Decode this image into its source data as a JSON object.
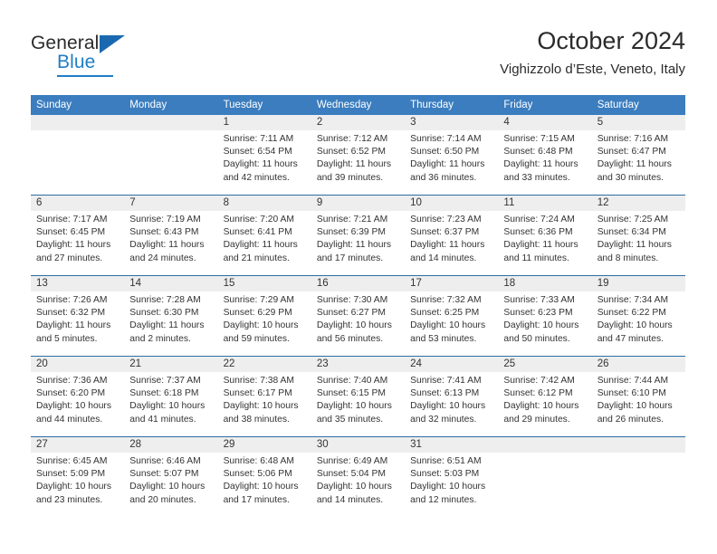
{
  "brand": {
    "name_part1": "General",
    "name_part2": "Blue",
    "accent_color": "#1f7ec4",
    "triangle_color": "#1a69b0"
  },
  "header": {
    "title": "October 2024",
    "subtitle": "Vighizzolo d’Este, Veneto, Italy"
  },
  "calendar": {
    "header_bg": "#3b7dbf",
    "row_rule_color": "#2e6da4",
    "daynum_bg": "#eeeeee",
    "weekdays": [
      "Sunday",
      "Monday",
      "Tuesday",
      "Wednesday",
      "Thursday",
      "Friday",
      "Saturday"
    ],
    "weeks": [
      [
        {
          "day": "",
          "empty": true
        },
        {
          "day": "",
          "empty": true
        },
        {
          "day": "1",
          "sunrise": "Sunrise: 7:11 AM",
          "sunset": "Sunset: 6:54 PM",
          "daylight1": "Daylight: 11 hours",
          "daylight2": "and 42 minutes."
        },
        {
          "day": "2",
          "sunrise": "Sunrise: 7:12 AM",
          "sunset": "Sunset: 6:52 PM",
          "daylight1": "Daylight: 11 hours",
          "daylight2": "and 39 minutes."
        },
        {
          "day": "3",
          "sunrise": "Sunrise: 7:14 AM",
          "sunset": "Sunset: 6:50 PM",
          "daylight1": "Daylight: 11 hours",
          "daylight2": "and 36 minutes."
        },
        {
          "day": "4",
          "sunrise": "Sunrise: 7:15 AM",
          "sunset": "Sunset: 6:48 PM",
          "daylight1": "Daylight: 11 hours",
          "daylight2": "and 33 minutes."
        },
        {
          "day": "5",
          "sunrise": "Sunrise: 7:16 AM",
          "sunset": "Sunset: 6:47 PM",
          "daylight1": "Daylight: 11 hours",
          "daylight2": "and 30 minutes."
        }
      ],
      [
        {
          "day": "6",
          "sunrise": "Sunrise: 7:17 AM",
          "sunset": "Sunset: 6:45 PM",
          "daylight1": "Daylight: 11 hours",
          "daylight2": "and 27 minutes."
        },
        {
          "day": "7",
          "sunrise": "Sunrise: 7:19 AM",
          "sunset": "Sunset: 6:43 PM",
          "daylight1": "Daylight: 11 hours",
          "daylight2": "and 24 minutes."
        },
        {
          "day": "8",
          "sunrise": "Sunrise: 7:20 AM",
          "sunset": "Sunset: 6:41 PM",
          "daylight1": "Daylight: 11 hours",
          "daylight2": "and 21 minutes."
        },
        {
          "day": "9",
          "sunrise": "Sunrise: 7:21 AM",
          "sunset": "Sunset: 6:39 PM",
          "daylight1": "Daylight: 11 hours",
          "daylight2": "and 17 minutes."
        },
        {
          "day": "10",
          "sunrise": "Sunrise: 7:23 AM",
          "sunset": "Sunset: 6:37 PM",
          "daylight1": "Daylight: 11 hours",
          "daylight2": "and 14 minutes."
        },
        {
          "day": "11",
          "sunrise": "Sunrise: 7:24 AM",
          "sunset": "Sunset: 6:36 PM",
          "daylight1": "Daylight: 11 hours",
          "daylight2": "and 11 minutes."
        },
        {
          "day": "12",
          "sunrise": "Sunrise: 7:25 AM",
          "sunset": "Sunset: 6:34 PM",
          "daylight1": "Daylight: 11 hours",
          "daylight2": "and 8 minutes."
        }
      ],
      [
        {
          "day": "13",
          "sunrise": "Sunrise: 7:26 AM",
          "sunset": "Sunset: 6:32 PM",
          "daylight1": "Daylight: 11 hours",
          "daylight2": "and 5 minutes."
        },
        {
          "day": "14",
          "sunrise": "Sunrise: 7:28 AM",
          "sunset": "Sunset: 6:30 PM",
          "daylight1": "Daylight: 11 hours",
          "daylight2": "and 2 minutes."
        },
        {
          "day": "15",
          "sunrise": "Sunrise: 7:29 AM",
          "sunset": "Sunset: 6:29 PM",
          "daylight1": "Daylight: 10 hours",
          "daylight2": "and 59 minutes."
        },
        {
          "day": "16",
          "sunrise": "Sunrise: 7:30 AM",
          "sunset": "Sunset: 6:27 PM",
          "daylight1": "Daylight: 10 hours",
          "daylight2": "and 56 minutes."
        },
        {
          "day": "17",
          "sunrise": "Sunrise: 7:32 AM",
          "sunset": "Sunset: 6:25 PM",
          "daylight1": "Daylight: 10 hours",
          "daylight2": "and 53 minutes."
        },
        {
          "day": "18",
          "sunrise": "Sunrise: 7:33 AM",
          "sunset": "Sunset: 6:23 PM",
          "daylight1": "Daylight: 10 hours",
          "daylight2": "and 50 minutes."
        },
        {
          "day": "19",
          "sunrise": "Sunrise: 7:34 AM",
          "sunset": "Sunset: 6:22 PM",
          "daylight1": "Daylight: 10 hours",
          "daylight2": "and 47 minutes."
        }
      ],
      [
        {
          "day": "20",
          "sunrise": "Sunrise: 7:36 AM",
          "sunset": "Sunset: 6:20 PM",
          "daylight1": "Daylight: 10 hours",
          "daylight2": "and 44 minutes."
        },
        {
          "day": "21",
          "sunrise": "Sunrise: 7:37 AM",
          "sunset": "Sunset: 6:18 PM",
          "daylight1": "Daylight: 10 hours",
          "daylight2": "and 41 minutes."
        },
        {
          "day": "22",
          "sunrise": "Sunrise: 7:38 AM",
          "sunset": "Sunset: 6:17 PM",
          "daylight1": "Daylight: 10 hours",
          "daylight2": "and 38 minutes."
        },
        {
          "day": "23",
          "sunrise": "Sunrise: 7:40 AM",
          "sunset": "Sunset: 6:15 PM",
          "daylight1": "Daylight: 10 hours",
          "daylight2": "and 35 minutes."
        },
        {
          "day": "24",
          "sunrise": "Sunrise: 7:41 AM",
          "sunset": "Sunset: 6:13 PM",
          "daylight1": "Daylight: 10 hours",
          "daylight2": "and 32 minutes."
        },
        {
          "day": "25",
          "sunrise": "Sunrise: 7:42 AM",
          "sunset": "Sunset: 6:12 PM",
          "daylight1": "Daylight: 10 hours",
          "daylight2": "and 29 minutes."
        },
        {
          "day": "26",
          "sunrise": "Sunrise: 7:44 AM",
          "sunset": "Sunset: 6:10 PM",
          "daylight1": "Daylight: 10 hours",
          "daylight2": "and 26 minutes."
        }
      ],
      [
        {
          "day": "27",
          "sunrise": "Sunrise: 6:45 AM",
          "sunset": "Sunset: 5:09 PM",
          "daylight1": "Daylight: 10 hours",
          "daylight2": "and 23 minutes."
        },
        {
          "day": "28",
          "sunrise": "Sunrise: 6:46 AM",
          "sunset": "Sunset: 5:07 PM",
          "daylight1": "Daylight: 10 hours",
          "daylight2": "and 20 minutes."
        },
        {
          "day": "29",
          "sunrise": "Sunrise: 6:48 AM",
          "sunset": "Sunset: 5:06 PM",
          "daylight1": "Daylight: 10 hours",
          "daylight2": "and 17 minutes."
        },
        {
          "day": "30",
          "sunrise": "Sunrise: 6:49 AM",
          "sunset": "Sunset: 5:04 PM",
          "daylight1": "Daylight: 10 hours",
          "daylight2": "and 14 minutes."
        },
        {
          "day": "31",
          "sunrise": "Sunrise: 6:51 AM",
          "sunset": "Sunset: 5:03 PM",
          "daylight1": "Daylight: 10 hours",
          "daylight2": "and 12 minutes."
        },
        {
          "day": "",
          "empty": true
        },
        {
          "day": "",
          "empty": true
        }
      ]
    ]
  }
}
